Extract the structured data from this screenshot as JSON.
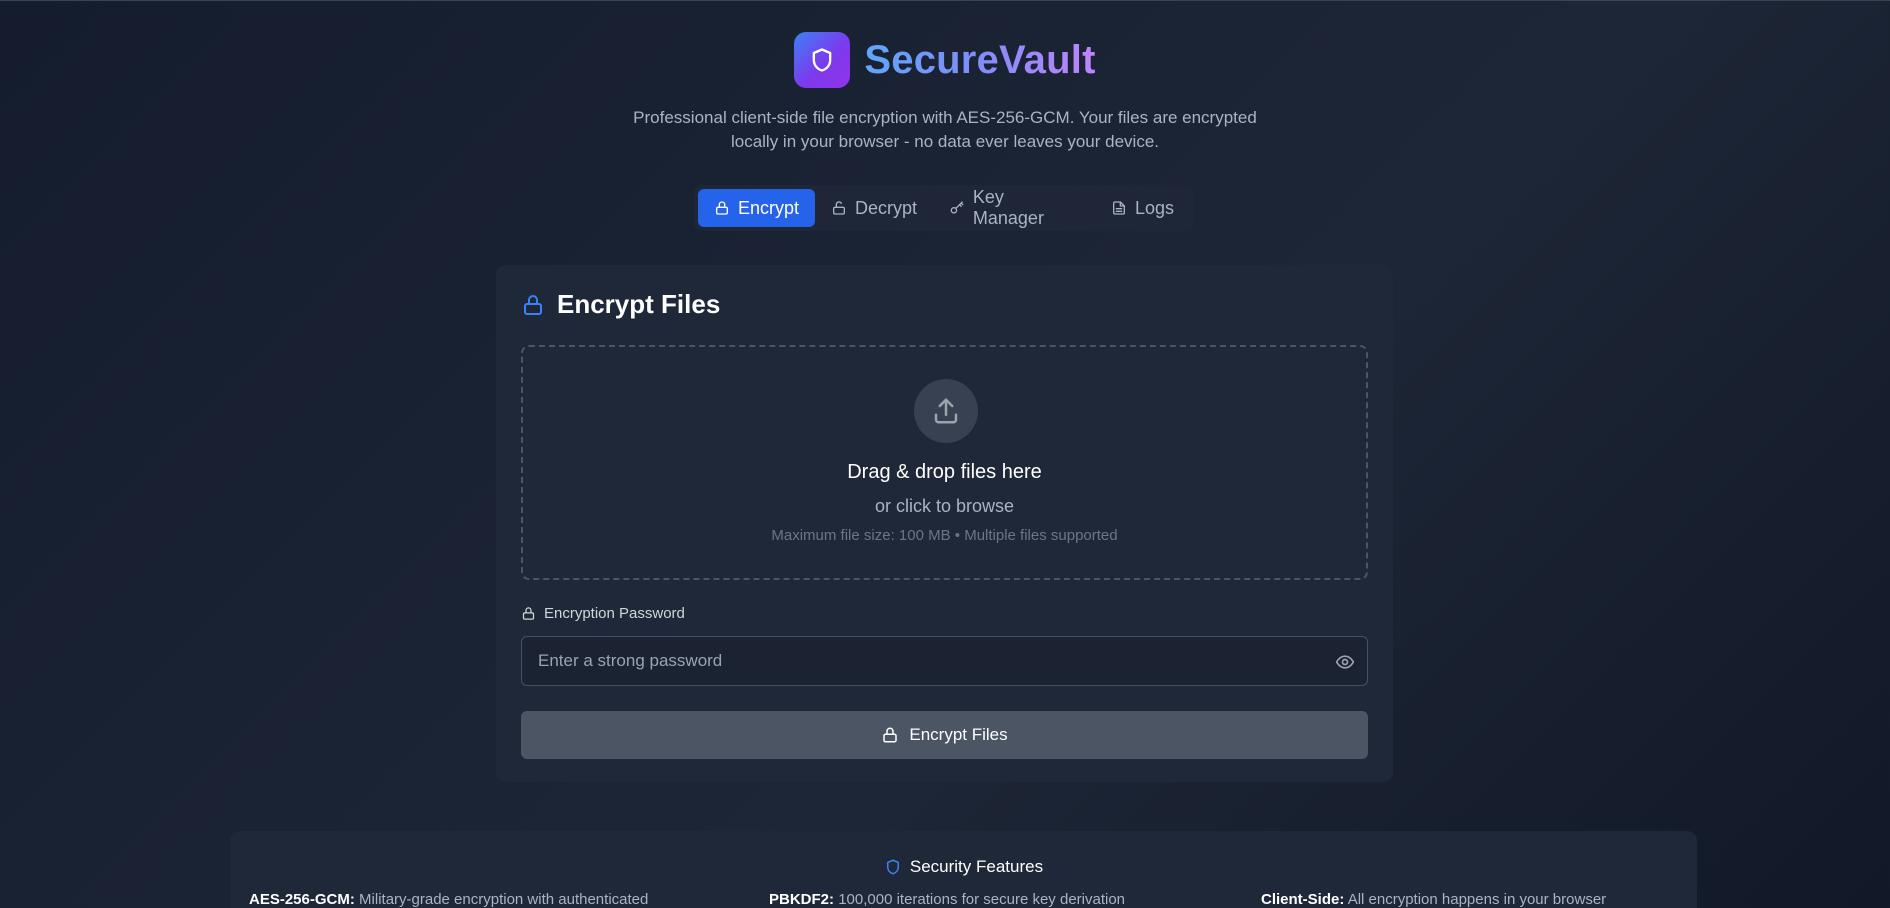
{
  "app": {
    "title": "SecureVault",
    "tagline_line1": "Professional client-side file encryption with AES-256-GCM. Your files are encrypted",
    "tagline_line2": "locally in your browser - no data ever leaves your device."
  },
  "tabs": [
    {
      "label": "Encrypt",
      "icon": "lock-icon",
      "active": true
    },
    {
      "label": "Decrypt",
      "icon": "unlock-icon",
      "active": false
    },
    {
      "label": "Key Manager",
      "icon": "key-icon",
      "active": false
    },
    {
      "label": "Logs",
      "icon": "document-icon",
      "active": false
    }
  ],
  "card": {
    "title": "Encrypt Files",
    "dropzone": {
      "title": "Drag & drop files here",
      "subtitle": "or click to browse",
      "hint": "Maximum file size: 100 MB • Multiple files supported"
    },
    "password": {
      "label": "Encryption Password",
      "placeholder": "Enter a strong password",
      "value": ""
    },
    "submit_label": "Encrypt Files"
  },
  "security": {
    "title": "Security Features",
    "items": [
      {
        "name": "AES-256-GCM:",
        "desc": "Military-grade encryption with authenticated"
      },
      {
        "name": "PBKDF2:",
        "desc": "100,000 iterations for secure key derivation"
      },
      {
        "name": "Client-Side:",
        "desc": "All encryption happens in your browser"
      }
    ]
  },
  "colors": {
    "accent": "#2563eb",
    "background": "#1b2435",
    "card": "#1f2838",
    "button_disabled": "#4b5563",
    "brand_gradient_start": "#60a5fa",
    "brand_gradient_end": "#c084fc"
  }
}
